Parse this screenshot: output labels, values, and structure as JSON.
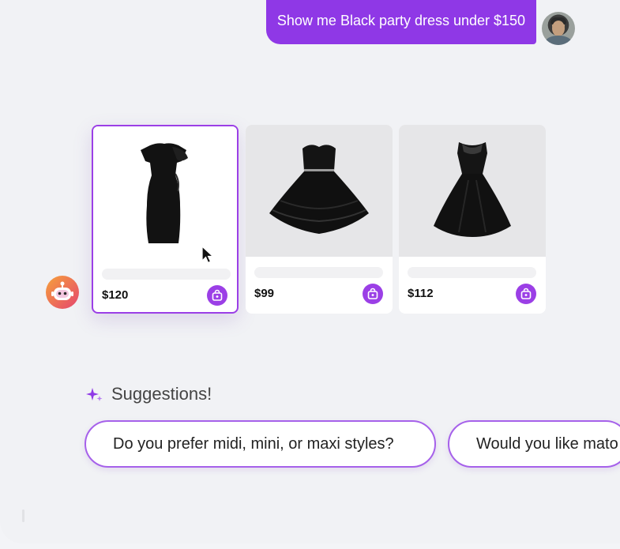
{
  "chat": {
    "user_message": "Show me Black party dress under $150",
    "user_avatar": "user-avatar",
    "bot_avatar": "robot-avatar-icon"
  },
  "products": [
    {
      "price": "$120",
      "icon": "cart-icon",
      "selected": true
    },
    {
      "price": "$99",
      "icon": "cart-icon",
      "selected": false
    },
    {
      "price": "$112",
      "icon": "cart-icon",
      "selected": false
    }
  ],
  "suggestions": {
    "title": "Suggestions!",
    "icon": "sparkle-icon",
    "items": [
      "Do you prefer midi, mini, or maxi styles?",
      "Would you like mato"
    ]
  },
  "colors": {
    "accent": "#8f38e6",
    "background": "#f1f2f5"
  }
}
